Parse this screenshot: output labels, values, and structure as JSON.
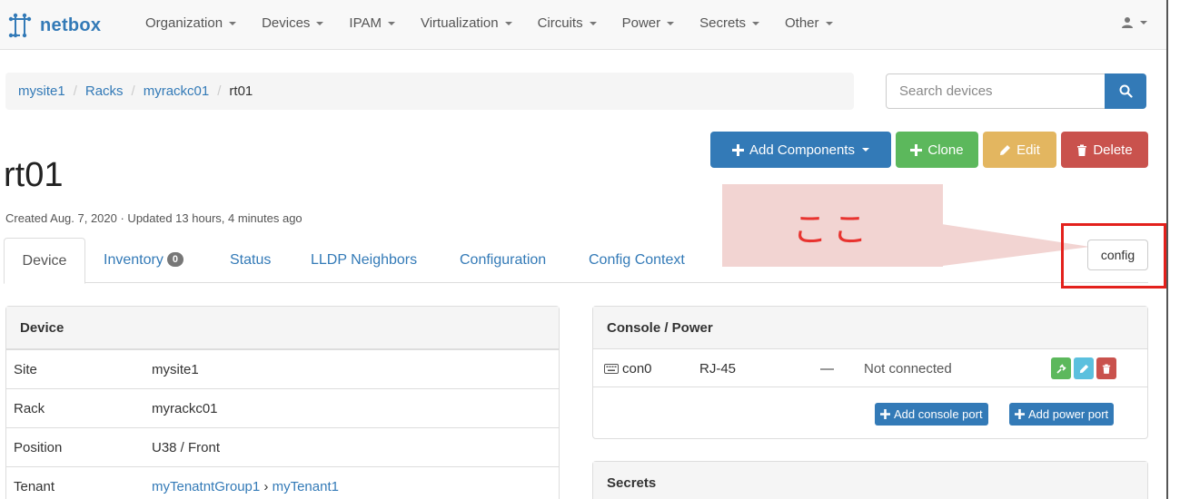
{
  "brand": {
    "name": "netbox"
  },
  "nav": {
    "items": [
      {
        "label": "Organization"
      },
      {
        "label": "Devices"
      },
      {
        "label": "IPAM"
      },
      {
        "label": "Virtualization"
      },
      {
        "label": "Circuits"
      },
      {
        "label": "Power"
      },
      {
        "label": "Secrets"
      },
      {
        "label": "Other"
      }
    ],
    "user_icon": "user-icon"
  },
  "breadcrumb": [
    "mysite1",
    "Racks",
    "myrackc01",
    "rt01"
  ],
  "search": {
    "placeholder": "Search devices",
    "icon": "search-icon"
  },
  "actions": {
    "add_components": "Add Components",
    "clone": "Clone",
    "edit": "Edit",
    "delete": "Delete"
  },
  "device": {
    "title": "rt01",
    "meta": "Created Aug. 7, 2020 · Updated 13 hours, 4 minutes ago"
  },
  "tabs": [
    {
      "label": "Device",
      "active": true
    },
    {
      "label": "Inventory",
      "badge": "0"
    },
    {
      "label": "Status"
    },
    {
      "label": "LLDP Neighbors"
    },
    {
      "label": "Configuration"
    },
    {
      "label": "Config Context"
    }
  ],
  "annotation": {
    "text": "ここ",
    "button_label": "config",
    "color": "#e3211c"
  },
  "device_panel": {
    "heading": "Device",
    "rows": [
      {
        "key": "Site",
        "value": "mysite1"
      },
      {
        "key": "Rack",
        "value": "myrackc01"
      },
      {
        "key": "Position",
        "value": "U38 / Front"
      },
      {
        "key": "Tenant",
        "value_group": "myTenatntGroup1",
        "sep": " › ",
        "value": "myTenant1"
      }
    ]
  },
  "console_panel": {
    "heading": "Console / Power",
    "port": {
      "name": "con0",
      "type": "RJ-45",
      "dash": "—",
      "status": "Not connected"
    },
    "add_console": "Add console port",
    "add_power": "Add power port"
  },
  "secrets_panel": {
    "heading": "Secrets"
  },
  "colors": {
    "primary": "#337ab7",
    "success": "#5cb85c",
    "warning": "#e3b660",
    "danger": "#c9524d"
  }
}
